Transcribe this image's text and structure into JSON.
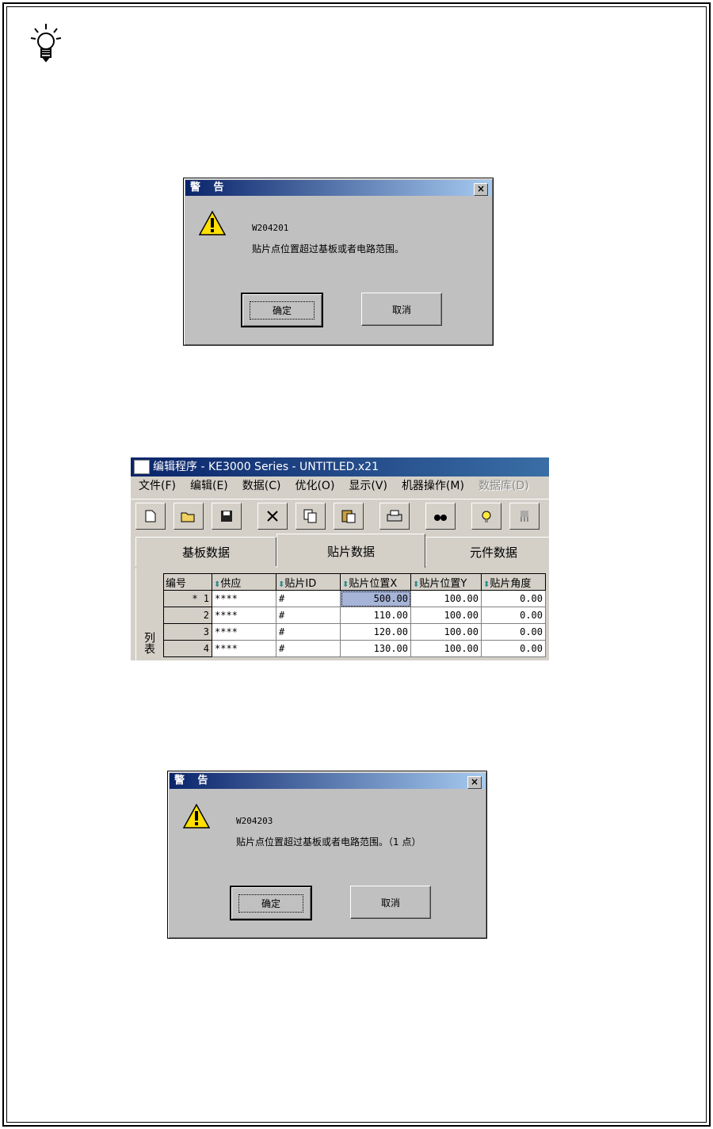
{
  "dialog1": {
    "title": "警 告",
    "close": "×",
    "code": "W204201",
    "message": "贴片点位置超过基板或者电路范围。",
    "ok": "确定",
    "cancel": "取消"
  },
  "editor": {
    "title": "编辑程序 - KE3000 Series - UNTITLED.x21",
    "menu": [
      "文件(F)",
      "编辑(E)",
      "数据(C)",
      "优化(O)",
      "显示(V)",
      "机器操作(M)",
      "数据库(D)"
    ],
    "tabs": [
      "基板数据",
      "贴片数据",
      "元件数据"
    ],
    "side_label": "列表",
    "columns": [
      "编号",
      "供应",
      "贴片ID",
      "贴片位置X",
      "贴片位置Y",
      "贴片角度"
    ],
    "rows": [
      {
        "no": "* 1",
        "feed": "****",
        "id": "#",
        "x": "500.00",
        "y": "100.00",
        "angle": "0.00"
      },
      {
        "no": "2",
        "feed": "****",
        "id": "#",
        "x": "110.00",
        "y": "100.00",
        "angle": "0.00"
      },
      {
        "no": "3",
        "feed": "****",
        "id": "#",
        "x": "120.00",
        "y": "100.00",
        "angle": "0.00"
      },
      {
        "no": "4",
        "feed": "****",
        "id": "#",
        "x": "130.00",
        "y": "100.00",
        "angle": "0.00"
      }
    ],
    "sort_glyph": "⬍"
  },
  "dialog2": {
    "title": "警 告",
    "close": "×",
    "code": "W204203",
    "message": "贴片点位置超过基板或者电路范围。（1 点）",
    "ok": "确定",
    "cancel": "取消"
  }
}
